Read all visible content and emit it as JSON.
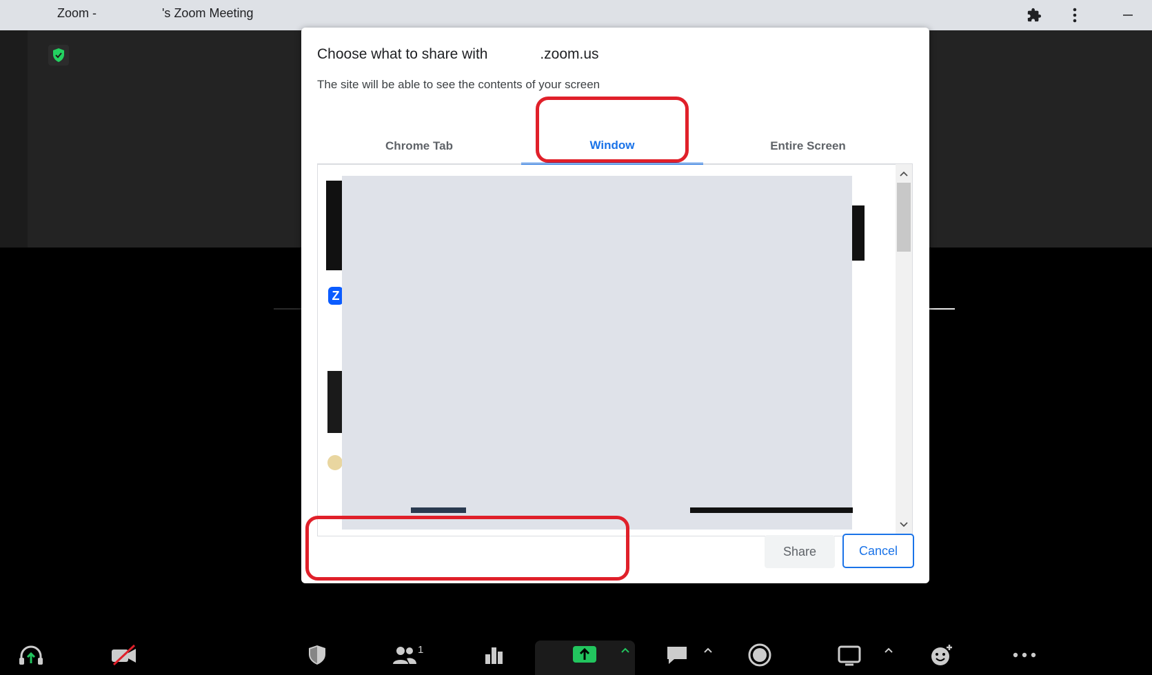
{
  "window": {
    "title_prefix": "Zoom -",
    "title_suffix": "'s Zoom Meeting"
  },
  "dialog": {
    "title_prefix": "Choose what to share with",
    "title_domain": ".zoom.us",
    "subtitle": "The site will be able to see the contents of your screen",
    "tabs": [
      {
        "label": "Chrome Tab",
        "active": false
      },
      {
        "label": "Window",
        "active": true
      },
      {
        "label": "Entire Screen",
        "active": false
      }
    ],
    "share_label": "Share",
    "cancel_label": "Cancel"
  },
  "toolbar": {
    "participants_count": "1",
    "items": [
      "unmute-audio",
      "start-video",
      "security",
      "participants",
      "polls",
      "share-screen",
      "chat",
      "record",
      "whiteboards",
      "reactions",
      "more"
    ]
  },
  "colors": {
    "accent": "#1a73e8",
    "annotation": "#e0202a",
    "share_green": "#22c55e",
    "secure_green": "#23d160"
  }
}
